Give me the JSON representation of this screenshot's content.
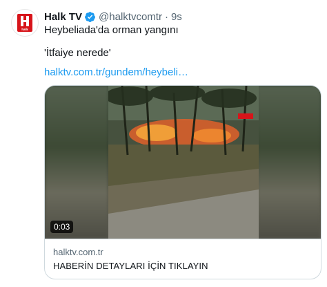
{
  "author": {
    "name": "Halk TV",
    "handle": "@halktvcomtr",
    "separator": "·",
    "time": "9s",
    "verified_icon": "verified-badge-icon",
    "avatar_logo_text": "halk"
  },
  "tweet": {
    "line1": "Heybeliada'da orman yangını",
    "line2": "'İtfaiye nerede'",
    "link": "halktv.com.tr/gundem/heybeli…"
  },
  "card": {
    "video_duration": "0:03",
    "domain": "halktv.com.tr",
    "title": "HABERİN DETAYLARI İÇİN TIKLAYIN"
  },
  "colors": {
    "link": "#1d9bf0",
    "secondary_text": "#536471",
    "border": "#cfd9de",
    "brand_red": "#d7141a"
  }
}
